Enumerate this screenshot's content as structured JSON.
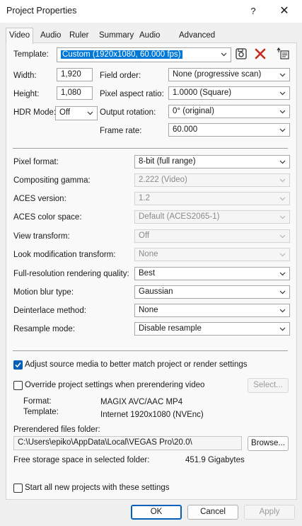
{
  "title": "Project Properties",
  "help_label": "?",
  "close_label": "✕",
  "tabs": [
    "Video",
    "Audio",
    "Ruler",
    "Summary",
    "Audio CD",
    "Advanced"
  ],
  "template": {
    "label": "Template:",
    "value": "Custom (1920x1080, 60.000 fps)"
  },
  "width": {
    "label": "Width:",
    "value": "1,920"
  },
  "height": {
    "label": "Height:",
    "value": "1,080"
  },
  "hdr": {
    "label": "HDR Mode:",
    "value": "Off"
  },
  "field_order": {
    "label": "Field order:",
    "value": "None (progressive scan)"
  },
  "pixel_aspect": {
    "label": "Pixel aspect ratio:",
    "value": "1.0000 (Square)"
  },
  "output_rotation": {
    "label": "Output rotation:",
    "value": "0° (original)"
  },
  "frame_rate": {
    "label": "Frame rate:",
    "value": "60.000"
  },
  "settings": [
    {
      "label": "Pixel format:",
      "value": "8-bit (full range)",
      "enabled": true
    },
    {
      "label": "Compositing gamma:",
      "value": "2.222 (Video)",
      "enabled": false
    },
    {
      "label": "ACES version:",
      "value": "1.2",
      "enabled": false
    },
    {
      "label": "ACES color space:",
      "value": "Default (ACES2065-1)",
      "enabled": false
    },
    {
      "label": "View transform:",
      "value": "Off",
      "enabled": false
    },
    {
      "label": "Look modification transform:",
      "value": "None",
      "enabled": false
    },
    {
      "label": "Full-resolution rendering quality:",
      "value": "Best",
      "enabled": true
    },
    {
      "label": "Motion blur type:",
      "value": "Gaussian",
      "enabled": true
    },
    {
      "label": "Deinterlace method:",
      "value": "None",
      "enabled": true
    },
    {
      "label": "Resample mode:",
      "value": "Disable resample",
      "enabled": true
    }
  ],
  "adjust_source": {
    "label": "Adjust source media to better match project or render settings",
    "checked": true
  },
  "override_prerender": {
    "label": "Override project settings when prerendering video",
    "checked": false
  },
  "select_button": "Select...",
  "prerender_format": {
    "label": "Format:",
    "value": "MAGIX AVC/AAC MP4"
  },
  "prerender_template": {
    "label": "Template:",
    "value": "Internet 1920x1080 (NVEnc)"
  },
  "prerendered_folder": {
    "label": "Prerendered files folder:",
    "value": "C:\\Users\\epiko\\AppData\\Local\\VEGAS Pro\\20.0\\"
  },
  "browse_button": "Browse...",
  "free_space": {
    "label": "Free storage space in selected folder:",
    "value": "451.9 Gigabytes"
  },
  "start_all_new": {
    "label": "Start all new projects with these settings",
    "checked": false
  },
  "buttons": {
    "ok": "OK",
    "cancel": "Cancel",
    "apply": "Apply"
  },
  "colors": {
    "accent": "#005fb8",
    "selection": "#0078d7",
    "delete_icon": "#c42b1c"
  }
}
